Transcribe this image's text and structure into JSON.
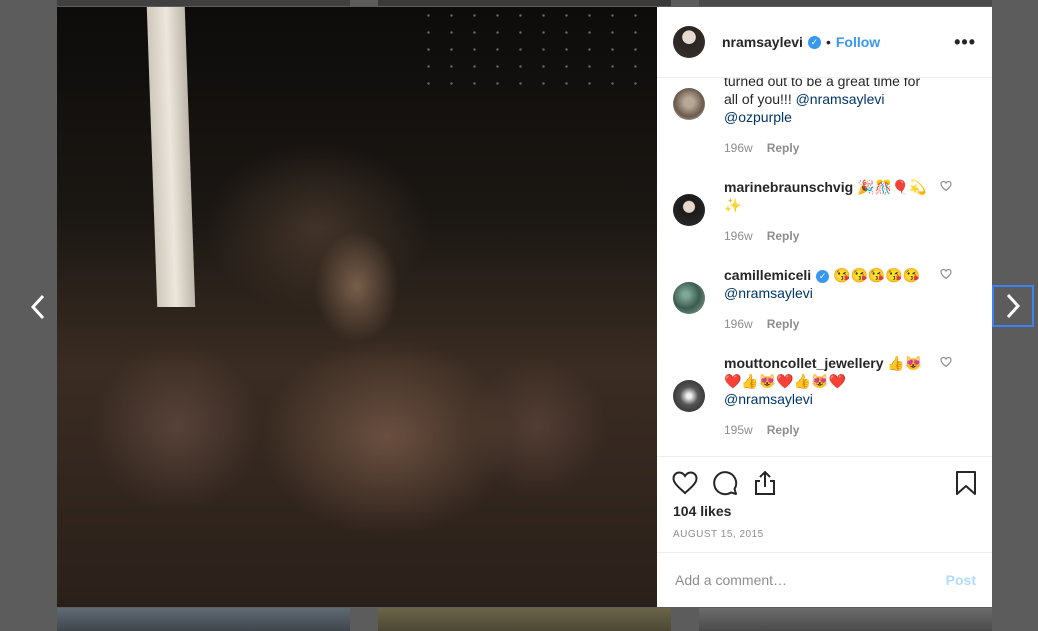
{
  "post": {
    "username": "nramsaylevi",
    "follow_label": "Follow",
    "separator": "•",
    "more_label": "•••"
  },
  "comments": [
    {
      "text_line1": "turned out to be a great time for",
      "text_line2": "all of you!!!",
      "mention1": "@nramsaylevi",
      "mention2": "@ozpurple",
      "age": "196w",
      "reply": "Reply"
    },
    {
      "username": "marinebraunschvig",
      "text": "🎉🎊🎈💫✨",
      "age": "196w",
      "reply": "Reply"
    },
    {
      "username": "camillemiceli",
      "text": "😘😘😘😘😘",
      "mention": "@nramsaylevi",
      "age": "196w",
      "reply": "Reply"
    },
    {
      "username": "mouttoncollet_jewellery",
      "text": "👍😻",
      "text2": "❤️👍😻❤️👍😻❤️",
      "mention": "@nramsaylevi",
      "age": "195w",
      "reply": "Reply"
    }
  ],
  "likes": "104 likes",
  "date": "AUGUST 15, 2015",
  "add_comment_placeholder": "Add a comment…",
  "post_button": "Post",
  "colors": {
    "accent": "#3897f0",
    "text": "#262626",
    "muted": "#8e8e8e",
    "backdrop": "#5c5c5c"
  }
}
